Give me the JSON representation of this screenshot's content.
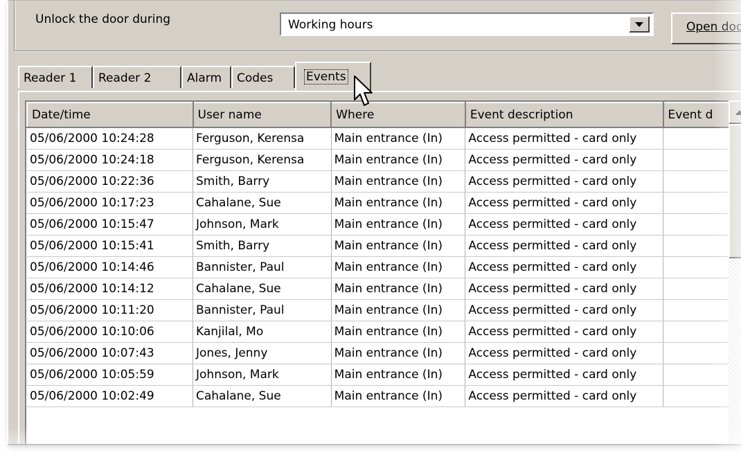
{
  "door": {
    "unlock_label": "Unlock the door during",
    "unlock_value": "Working hours",
    "open_door_label": "Open doo"
  },
  "tabs": [
    {
      "label": "Reader 1"
    },
    {
      "label": "Reader 2"
    },
    {
      "label": "Alarm"
    },
    {
      "label": "Codes"
    },
    {
      "label": "Events",
      "active": true
    }
  ],
  "events_table": {
    "columns": [
      "Date/time",
      "User name",
      "Where",
      "Event description",
      "Event d"
    ],
    "rows": [
      [
        "05/06/2000  10:24:28",
        "Ferguson, Kerensa",
        "Main entrance (In)",
        "Access permitted - card only",
        ""
      ],
      [
        "05/06/2000  10:24:18",
        "Ferguson, Kerensa",
        "Main entrance (In)",
        "Access permitted - card only",
        ""
      ],
      [
        "05/06/2000  10:22:36",
        "Smith, Barry",
        "Main entrance (In)",
        "Access permitted - card only",
        ""
      ],
      [
        "05/06/2000  10:17:23",
        "Cahalane, Sue",
        "Main entrance (In)",
        "Access permitted - card only",
        ""
      ],
      [
        "05/06/2000  10:15:47",
        "Johnson, Mark",
        "Main entrance (In)",
        "Access permitted - card only",
        ""
      ],
      [
        "05/06/2000  10:15:41",
        "Smith, Barry",
        "Main entrance (In)",
        "Access permitted - card only",
        ""
      ],
      [
        "05/06/2000  10:14:46",
        "Bannister, Paul",
        "Main entrance (In)",
        "Access permitted - card only",
        ""
      ],
      [
        "05/06/2000  10:14:12",
        "Cahalane, Sue",
        "Main entrance (In)",
        "Access permitted - card only",
        ""
      ],
      [
        "05/06/2000  10:11:20",
        "Bannister, Paul",
        "Main entrance (In)",
        "Access permitted - card only",
        ""
      ],
      [
        "05/06/2000  10:10:06",
        "Kanjilal, Mo",
        "Main entrance (In)",
        "Access permitted - card only",
        ""
      ],
      [
        "05/06/2000  10:07:43",
        "Jones, Jenny",
        "Main entrance (In)",
        "Access permitted - card only",
        ""
      ],
      [
        "05/06/2000  10:05:59",
        "Johnson, Mark",
        "Main entrance (In)",
        "Access permitted - card only",
        ""
      ],
      [
        "05/06/2000  10:02:49",
        "Cahalane, Sue",
        "Main entrance (In)",
        "Access permitted - card only",
        ""
      ]
    ]
  },
  "icons": {
    "combo_dropdown": "chevron-down-icon",
    "scroll_up": "scroll-up-arrow-icon",
    "cursor": "mouse-pointer-icon"
  },
  "colors": {
    "face": "#d4d0c8",
    "shadow": "#808080",
    "highlight": "#ffffff"
  }
}
